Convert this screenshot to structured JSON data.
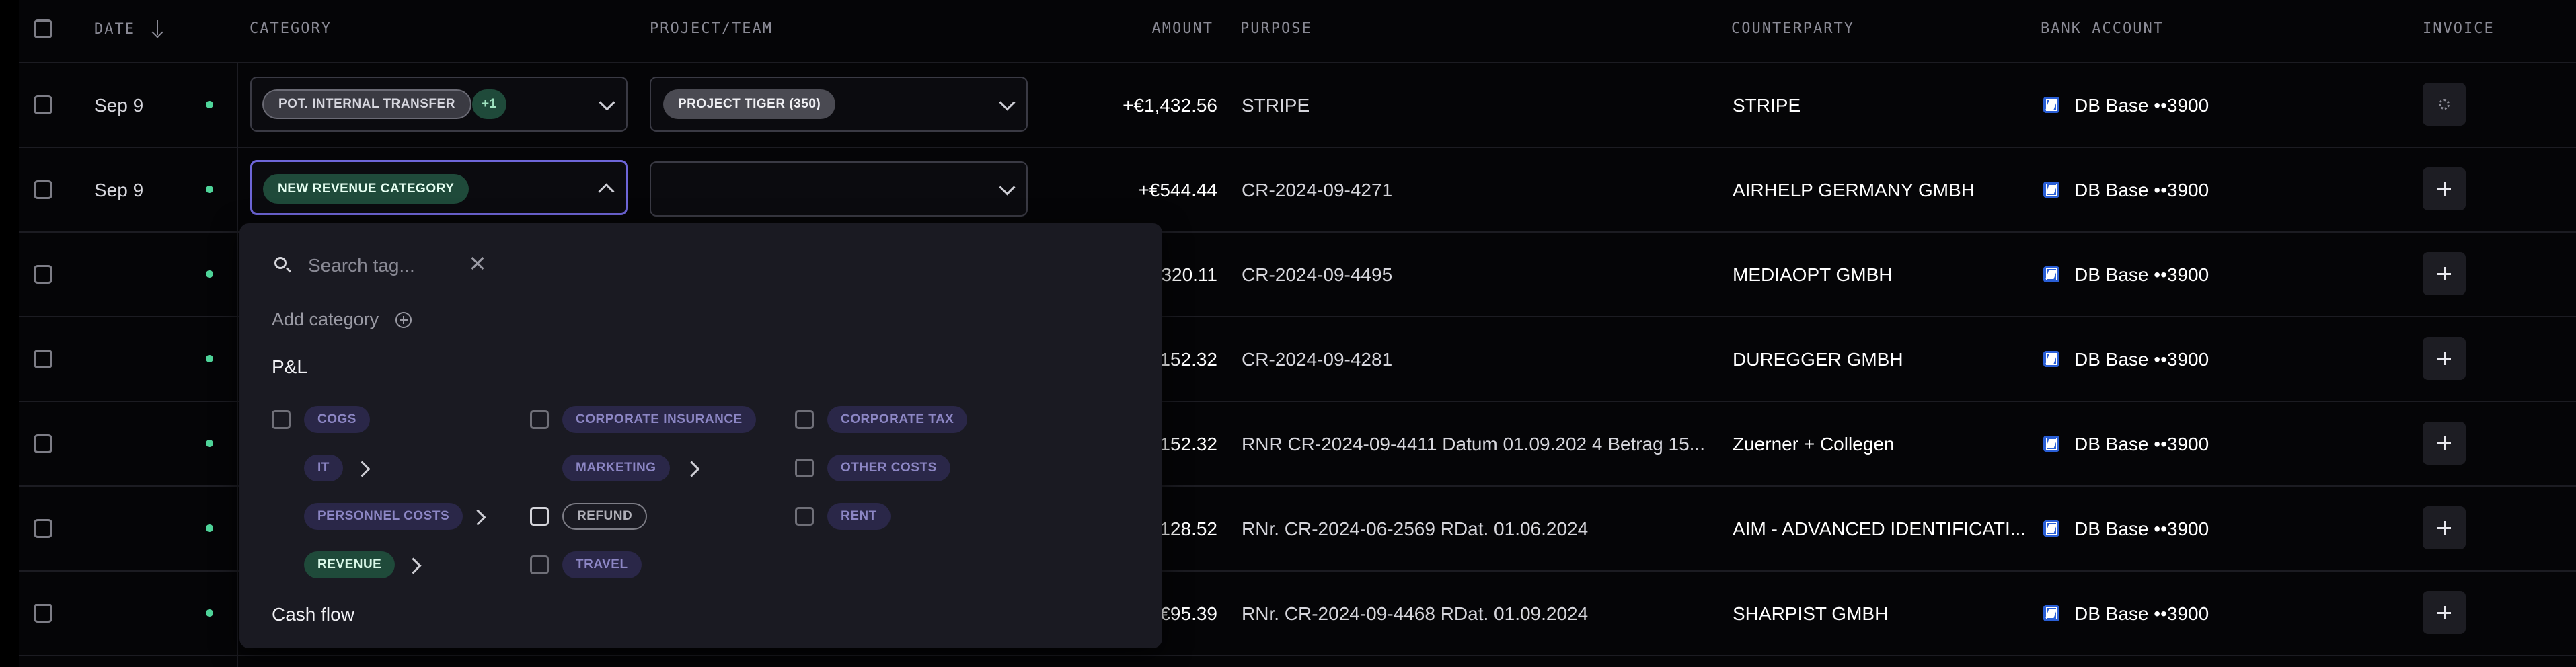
{
  "headers": {
    "date": "DATE",
    "category": "CATEGORY",
    "project": "PROJECT/TEAM",
    "amount": "AMOUNT",
    "purpose": "PURPOSE",
    "counterparty": "COUNTERPARTY",
    "bank": "BANK ACCOUNT",
    "invoice": "INVOICE"
  },
  "rows": [
    {
      "date": "Sep 9",
      "category": "POT. INTERNAL TRANSFER",
      "category_extra": "+1",
      "project": "PROJECT TIGER (350)",
      "amount": "+€1,432.56",
      "purpose": "STRIPE",
      "counterparty": "STRIPE",
      "bank": "DB Base ••3900",
      "invoice": "loading"
    },
    {
      "date": "Sep 9",
      "category": "NEW REVENUE CATEGORY",
      "project": "",
      "amount": "+€544.44",
      "purpose": "CR-2024-09-4271",
      "counterparty": "AIRHELP GERMANY GMBH",
      "bank": "DB Base ••3900",
      "invoice": "add"
    },
    {
      "date": "",
      "amount": "320.11",
      "purpose": "CR-2024-09-4495",
      "counterparty": "MEDIAOPT GMBH",
      "bank": "DB Base ••3900",
      "invoice": "add"
    },
    {
      "date": "",
      "amount": "152.32",
      "purpose": "CR-2024-09-4281",
      "counterparty": "DUREGGER GMBH",
      "bank": "DB Base ••3900",
      "invoice": "add"
    },
    {
      "date": "",
      "amount": "152.32",
      "purpose": "RNR CR-2024-09-4411 Datum 01.09.202 4 Betrag 15...",
      "counterparty": "Zuerner + Collegen",
      "bank": "DB Base ••3900",
      "invoice": "add"
    },
    {
      "date": "",
      "amount": "128.52",
      "purpose": "RNr. CR-2024-06-2569 RDat. 01.06.2024",
      "counterparty": "AIM - ADVANCED IDENTIFICATI...",
      "bank": "DB Base ••3900",
      "invoice": "add"
    },
    {
      "date": "",
      "amount": "€95.39",
      "purpose": "RNr. CR-2024-09-4468 RDat. 01.09.2024",
      "counterparty": "SHARPIST GMBH",
      "bank": "DB Base ••3900",
      "invoice": "add"
    }
  ],
  "dropdown": {
    "search_placeholder": "Search tag...",
    "add_category": "Add category",
    "section_pl": "P&L",
    "section_cashflow": "Cash flow",
    "tags": {
      "cogs": "COGS",
      "it": "IT",
      "personnel": "PERSONNEL COSTS",
      "revenue": "REVENUE",
      "corp_insurance": "CORPORATE INSURANCE",
      "marketing": "MARKETING",
      "refund": "REFUND",
      "travel": "TRAVEL",
      "corp_tax": "CORPORATE TAX",
      "other_costs": "OTHER COSTS",
      "rent": "RENT"
    }
  },
  "icons": {
    "sort": "arrow-down-icon",
    "bank": "bank-logo-icon",
    "invoice_add": "plus-icon",
    "invoice_loading": "spinner-icon",
    "search": "search-icon",
    "clear": "close-icon",
    "add": "plus-circle-icon",
    "expand": "chevron-right-icon",
    "dropdown": "chevron-down-icon"
  },
  "colors": {
    "accent_focus": "#6e66d8",
    "status_dot": "#4fd59a",
    "revenue_tag": "#1f4a3a",
    "category_tag": "#2a2748"
  }
}
